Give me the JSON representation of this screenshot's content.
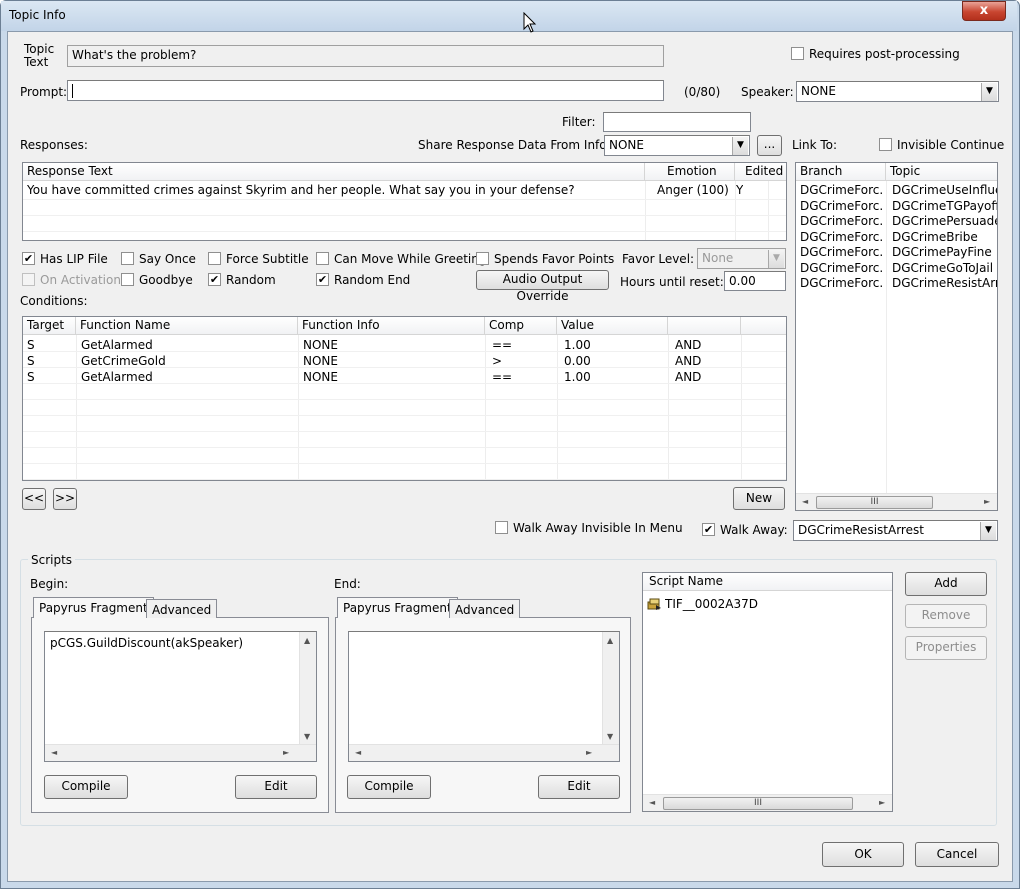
{
  "window": {
    "title": "Topic Info",
    "close_label": "x"
  },
  "topic": {
    "label_line1": "Topic",
    "label_line2": "Text",
    "value": "What's the problem?"
  },
  "requires_post_processing": {
    "label": "Requires post-processing",
    "checked": false
  },
  "prompt": {
    "label": "Prompt:",
    "value": "",
    "counter": "(0/80)"
  },
  "speaker": {
    "label": "Speaker:",
    "value": "NONE"
  },
  "filter": {
    "label": "Filter:",
    "value": ""
  },
  "responses": {
    "label": "Responses:",
    "share_label": "Share Response Data From Info:",
    "share_value": "NONE",
    "ellipsis": "...",
    "columns": [
      "Response Text",
      "Emotion",
      "Edited"
    ],
    "rows": [
      {
        "text": "You have committed crimes against Skyrim and her people. What say you in your defense?",
        "emotion": "Anger (100)",
        "edited": "Y"
      }
    ]
  },
  "link_to": {
    "label": "Link To:",
    "invisible_continue": "Invisible Continue",
    "columns": [
      "Branch",
      "Topic"
    ],
    "rows": [
      {
        "branch": "DGCrimeForc...",
        "topic": "DGCrimeUseInfluen"
      },
      {
        "branch": "DGCrimeForc...",
        "topic": "DGCrimeTGPayoff"
      },
      {
        "branch": "DGCrimeForc...",
        "topic": "DGCrimePersuade"
      },
      {
        "branch": "DGCrimeForc...",
        "topic": "DGCrimeBribe"
      },
      {
        "branch": "DGCrimeForc...",
        "topic": "DGCrimePayFine"
      },
      {
        "branch": "DGCrimeForc...",
        "topic": "DGCrimeGoToJail"
      },
      {
        "branch": "DGCrimeForc...",
        "topic": "DGCrimeResistArres"
      }
    ],
    "scroll_thumb": "III"
  },
  "options": {
    "has_lip": "Has LIP File",
    "say_once": "Say Once",
    "force_subtitle": "Force Subtitle",
    "can_move": "Can Move While Greeting",
    "spends_favor": "Spends Favor Points",
    "favor_level_label": "Favor Level:",
    "favor_level_value": "None",
    "on_activation": "On Activation",
    "goodbye": "Goodbye",
    "random": "Random",
    "random_end": "Random End",
    "audio_override": "Audio Output Override",
    "hours_label": "Hours until reset:",
    "hours_value": "0.00",
    "check_mark": "✔"
  },
  "conditions": {
    "label": "Conditions:",
    "columns": [
      "Target",
      "Function Name",
      "Function Info",
      "Comp",
      "Value",
      ""
    ],
    "rows": [
      {
        "target": "S",
        "function": "GetAlarmed",
        "info": "NONE",
        "comp": "==",
        "value": "1.00",
        "logic": "AND"
      },
      {
        "target": "S",
        "function": "GetCrimeGold",
        "info": "NONE",
        "comp": ">",
        "value": "0.00",
        "logic": "AND"
      },
      {
        "target": "S",
        "function": "GetAlarmed",
        "info": "NONE",
        "comp": "==",
        "value": "1.00",
        "logic": "AND"
      }
    ],
    "prev": "<<",
    "next": ">>",
    "new": "New"
  },
  "walk_away": {
    "invisible_label": "Walk Away Invisible In Menu",
    "label": "Walk Away:",
    "value": "DGCrimeResistArrest"
  },
  "scripts": {
    "group_label": "Scripts",
    "begin_label": "Begin:",
    "end_label": "End:",
    "tab_papyrus": "Papyrus Fragment",
    "tab_advanced": "Advanced",
    "begin_code": "pCGS.GuildDiscount(akSpeaker)",
    "end_code": "",
    "compile": "Compile",
    "edit": "Edit",
    "script_name_header": "Script Name",
    "scripts_list": [
      "TIF__0002A37D"
    ],
    "add": "Add",
    "remove": "Remove",
    "properties": "Properties"
  },
  "footer": {
    "ok": "OK",
    "cancel": "Cancel"
  },
  "glyphs": {
    "down": "▼",
    "up": "▲",
    "left": "◄",
    "right": "►",
    "thumb": "III"
  }
}
